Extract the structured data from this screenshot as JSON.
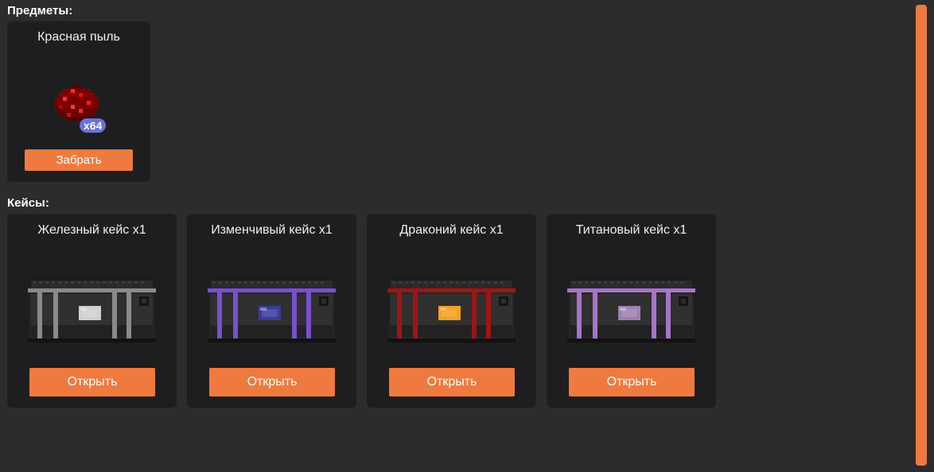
{
  "items_section": {
    "title": "Предметы:",
    "items": [
      {
        "name": "Красная пыль",
        "quantity": "x64",
        "button_label": "Забрать",
        "icon": "redstone-dust-icon"
      }
    ]
  },
  "cases_section": {
    "title": "Кейсы:",
    "cases": [
      {
        "name": "Железный кейс x1",
        "button_label": "Открыть",
        "icon": "iron-case-icon",
        "accent_color": "#8a8a8a",
        "emblem_color": "#d0d0d0"
      },
      {
        "name": "Изменчивый кейс x1",
        "button_label": "Открыть",
        "icon": "changeable-case-icon",
        "accent_color": "#7a4fd0",
        "emblem_color": "#3a3aa0"
      },
      {
        "name": "Драконий кейс x1",
        "button_label": "Открыть",
        "icon": "dragon-case-icon",
        "accent_color": "#a01414",
        "emblem_color": "#f5a020"
      },
      {
        "name": "Титановый кейс x1",
        "button_label": "Открыть",
        "icon": "titanium-case-icon",
        "accent_color": "#a874c8",
        "emblem_color": "#9c80b0"
      }
    ]
  },
  "colors": {
    "background": "#2c2c2e",
    "card": "#1e1e20",
    "accent": "#ef7a3f",
    "badge": "#6a73d9"
  }
}
